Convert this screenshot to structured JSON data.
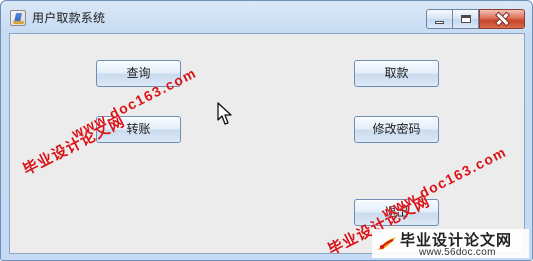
{
  "window": {
    "title": "用户取款系统",
    "icons": {
      "app": "java-app-icon",
      "minimize": "minimize-icon",
      "maximize": "maximize-icon",
      "close": "close-icon"
    }
  },
  "buttons": {
    "query": "查询",
    "transfer": "转账",
    "withdraw": "取款",
    "change_password": "修改密码",
    "exit": "退出"
  },
  "overlay": {
    "watermark_cn": "毕业设计论文网",
    "watermark_url": "www.doc163.com",
    "footer_brand": "毕业设计论文网",
    "footer_url": "www.56doc.com"
  },
  "colors": {
    "watermark": "#d91418",
    "window_frame": "#c6dbf3",
    "client_bg": "#ececec"
  }
}
